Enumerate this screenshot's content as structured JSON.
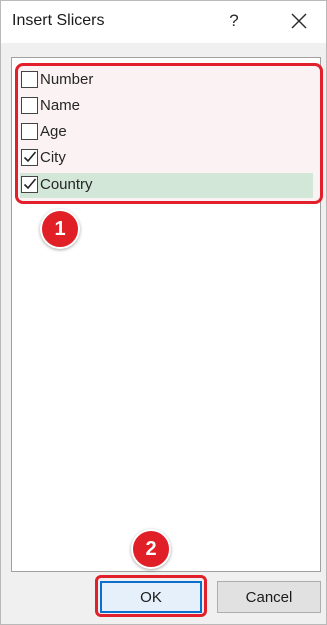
{
  "dialog": {
    "title": "Insert Slicers",
    "help_glyph": "?",
    "close_icon": "close-icon"
  },
  "fields": [
    {
      "label": "Number",
      "checked": false
    },
    {
      "label": "Name",
      "checked": false
    },
    {
      "label": "Age",
      "checked": false
    },
    {
      "label": "City",
      "checked": true
    },
    {
      "label": "Country",
      "checked": true
    }
  ],
  "annotations": {
    "step1": "1",
    "step2": "2"
  },
  "buttons": {
    "ok": "OK",
    "cancel": "Cancel"
  },
  "colors": {
    "annotation_red": "#e2202c",
    "selected_row": "#d3e7d8",
    "ok_border": "#0b6fd0"
  }
}
